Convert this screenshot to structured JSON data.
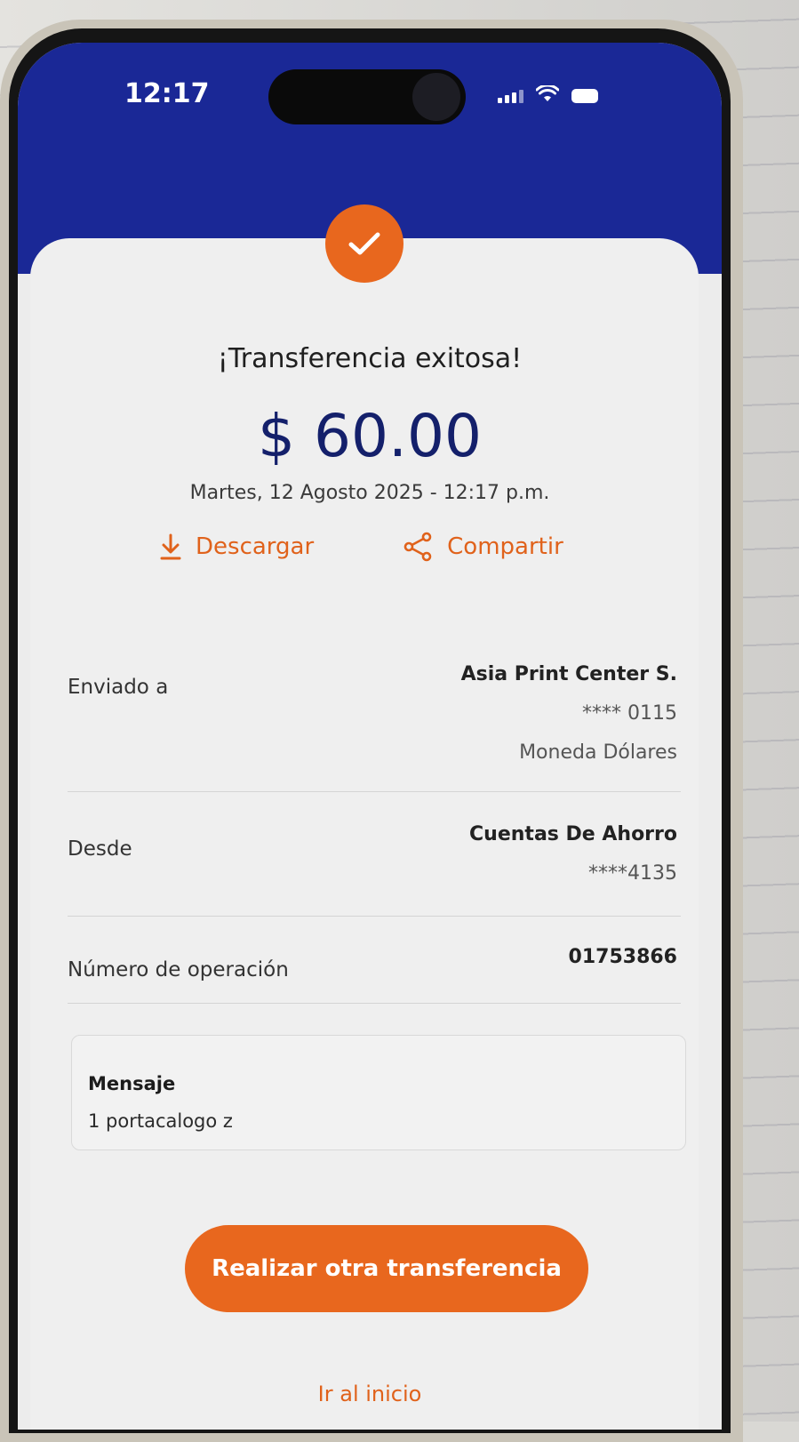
{
  "status_bar": {
    "time": "12:17"
  },
  "receipt": {
    "title": "¡Transferencia exitosa!",
    "amount": "$ 60.00",
    "datetime": "Martes, 12 Agosto 2025 - 12:17 p.m.",
    "actions": {
      "download_label": "Descargar",
      "share_label": "Compartir"
    },
    "sent_to": {
      "label": "Enviado a",
      "name": "Asia Print Center S.",
      "account": "**** 0115",
      "currency": "Moneda Dólares"
    },
    "from": {
      "label": "Desde",
      "account_type": "Cuentas De Ahorro",
      "account": "****4135"
    },
    "operation": {
      "label": "Número de operación",
      "number": "01753866"
    },
    "message": {
      "label": "Mensaje",
      "text": "1 portacalogo z"
    },
    "primary_button_label": "Realizar otra transferencia",
    "home_link_label": "Ir al inicio"
  },
  "colors": {
    "header_blue": "#1a2896",
    "accent_orange": "#e8671e",
    "amount_navy": "#14206b"
  },
  "icons": {
    "success": "check-icon",
    "download": "download-icon",
    "share": "share-icon"
  }
}
